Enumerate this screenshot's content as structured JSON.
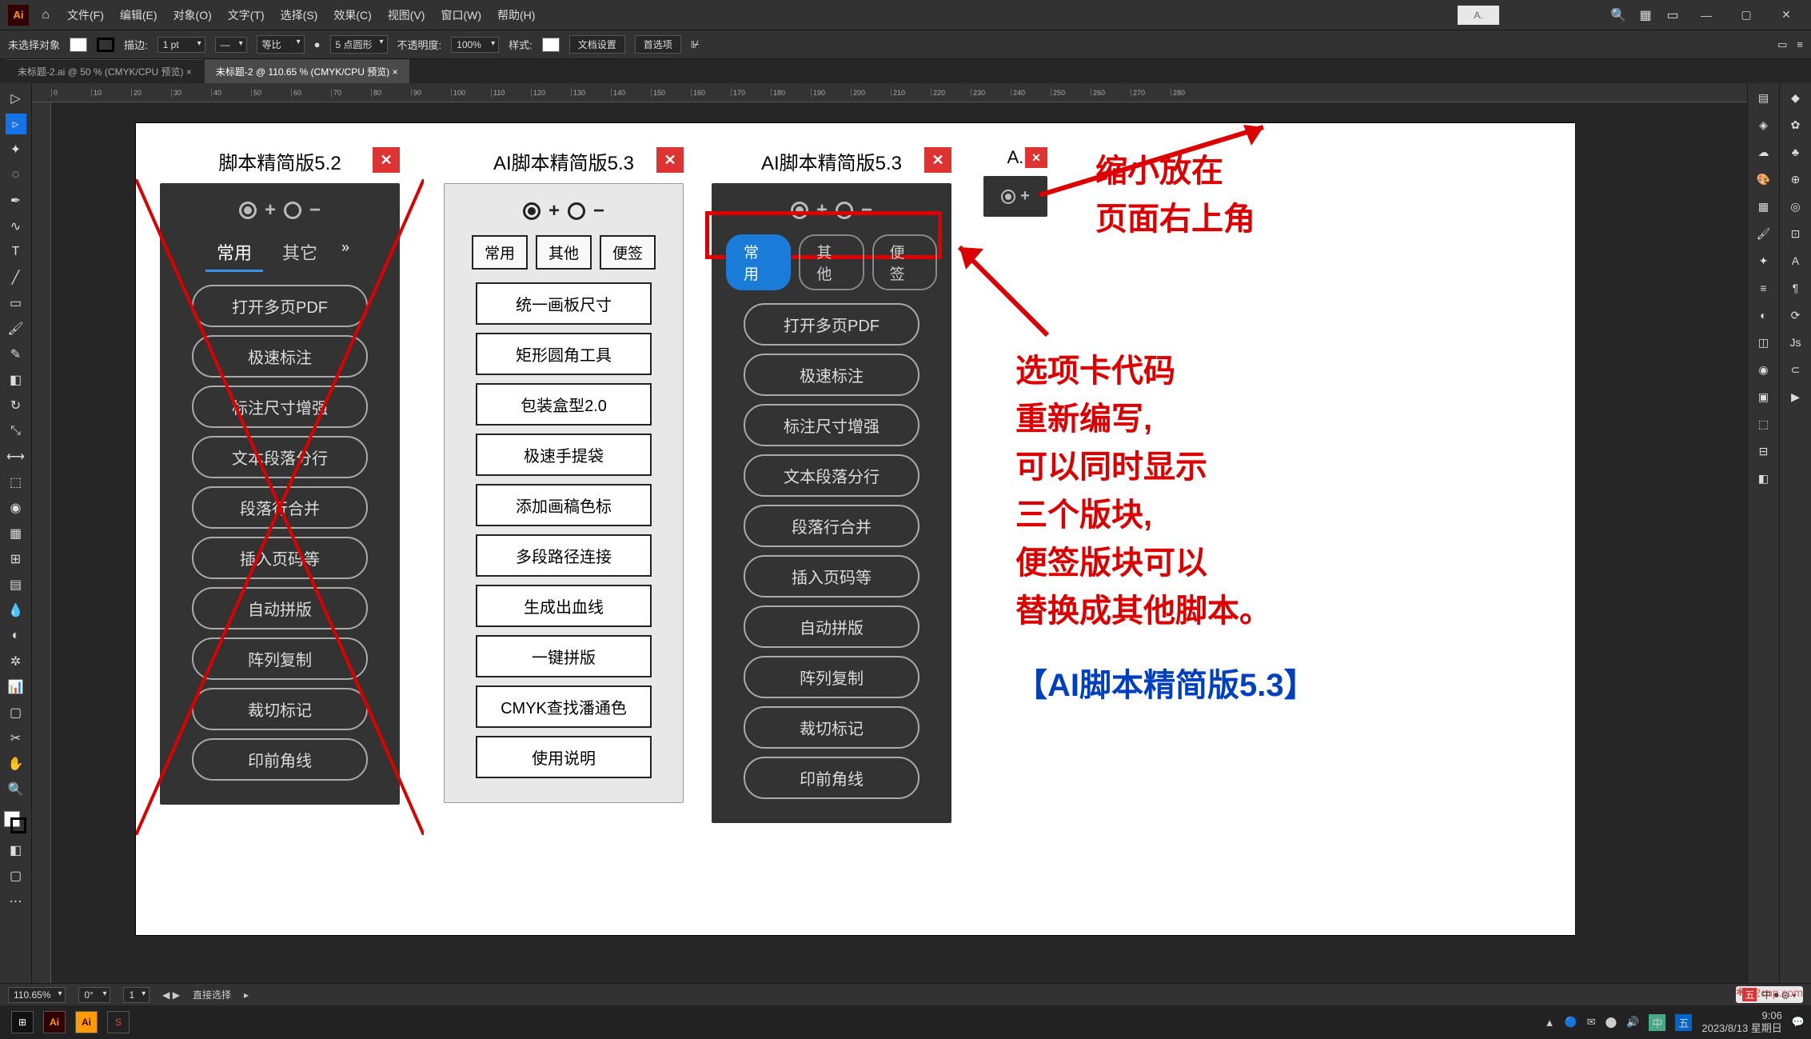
{
  "app": {
    "logo": "Ai"
  },
  "menubar": [
    "文件(F)",
    "编辑(E)",
    "对象(O)",
    "文字(T)",
    "选择(S)",
    "效果(C)",
    "视图(V)",
    "窗口(W)",
    "帮助(H)"
  ],
  "top_search_placeholder": "A.",
  "control_bar": {
    "no_selection": "未选择对象",
    "stroke_label": "描边:",
    "stroke_value": "1 pt",
    "uniform": "等比",
    "corner_value": "5 点圆形",
    "opacity_label": "不透明度:",
    "opacity_value": "100%",
    "style_label": "样式:",
    "doc_setup": "文档设置",
    "prefs": "首选项"
  },
  "tabs": [
    {
      "label": "未标题-2.ai @ 50 % (CMYK/CPU 预览)",
      "active": false
    },
    {
      "label": "未标题-2 @ 110.65 % (CMYK/CPU 预览)",
      "active": true
    }
  ],
  "ruler_ticks": [
    "0",
    "10",
    "20",
    "30",
    "40",
    "50",
    "60",
    "70",
    "80",
    "90",
    "100",
    "110",
    "120",
    "130",
    "140",
    "150",
    "160",
    "170",
    "180",
    "190",
    "200",
    "210",
    "220",
    "230",
    "240",
    "250",
    "260",
    "270",
    "280"
  ],
  "panel52": {
    "title": "脚本精简版5.2",
    "tabs": [
      "常用",
      "其它"
    ],
    "buttons": [
      "打开多页PDF",
      "极速标注",
      "标注尺寸增强",
      "文本段落分行",
      "段落行合并",
      "插入页码等",
      "自动拼版",
      "阵列复制",
      "裁切标记",
      "印前角线"
    ]
  },
  "panel53_light": {
    "title": "AI脚本精简版5.3",
    "tabs": [
      "常用",
      "其他",
      "便签"
    ],
    "buttons": [
      "统一画板尺寸",
      "矩形圆角工具",
      "包装盒型2.0",
      "极速手提袋",
      "添加画稿色标",
      "多段路径连接",
      "生成出血线",
      "一键拼版",
      "CMYK查找潘通色",
      "使用说明"
    ]
  },
  "panel53_dark": {
    "title": "AI脚本精简版5.3",
    "tabs": [
      "常用",
      "其他",
      "便签"
    ],
    "buttons": [
      "打开多页PDF",
      "极速标注",
      "标注尺寸增强",
      "文本段落分行",
      "段落行合并",
      "插入页码等",
      "自动拼版",
      "阵列复制",
      "裁切标记",
      "印前角线"
    ]
  },
  "panel_mini": {
    "title": "A."
  },
  "annotations": {
    "topright1": "缩小放在",
    "topright2": "页面右上角",
    "body1": "选项卡代码",
    "body2": "重新编写,",
    "body3": "可以同时显示",
    "body4": "三个版块,",
    "body5": "便签版块可以",
    "body6": "替换成其他脚本。",
    "footer": "【AI脚本精简版5.3】"
  },
  "status_bar": {
    "zoom": "110.65%",
    "rotate": "0°",
    "artboard": "1",
    "tool": "直接选择"
  },
  "taskbar": {
    "time": "9:06",
    "date": "2023/8/13 星期日",
    "ime": "中",
    "tray_lang": "五"
  },
  "watermark": "52cnp.com"
}
